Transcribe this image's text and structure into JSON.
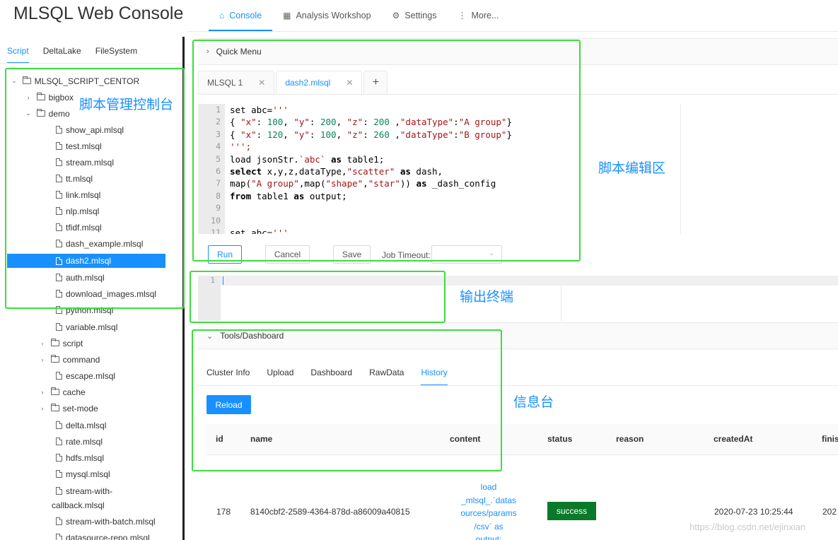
{
  "header": {
    "app_title": "MLSQL Web Console",
    "nav": [
      {
        "label": "Console",
        "icon": "home-icon",
        "active": true
      },
      {
        "label": "Analysis Workshop",
        "icon": "grid-icon",
        "active": false
      },
      {
        "label": "Settings",
        "icon": "gear-icon",
        "active": false
      },
      {
        "label": "More...",
        "icon": "more-icon",
        "active": false
      }
    ]
  },
  "sidebar": {
    "tabs": [
      "Script",
      "DeltaLake",
      "FileSystem"
    ],
    "active_tab": "Script",
    "tree": [
      {
        "label": "MLSQL_SCRIPT_CENTOR",
        "type": "folder",
        "expanded": true
      },
      {
        "label": "bigbox",
        "type": "folder",
        "expanded": false
      },
      {
        "label": "demo",
        "type": "folder",
        "expanded": true
      },
      {
        "label": "show_api.mlsql",
        "type": "file"
      },
      {
        "label": "test.mlsql",
        "type": "file"
      },
      {
        "label": "stream.mlsql",
        "type": "file"
      },
      {
        "label": "tt.mlsql",
        "type": "file"
      },
      {
        "label": "link.mlsql",
        "type": "file"
      },
      {
        "label": "nlp.mlsql",
        "type": "file"
      },
      {
        "label": "tfidf.mlsql",
        "type": "file"
      },
      {
        "label": "dash_example.mlsql",
        "type": "file"
      },
      {
        "label": "dash2.mlsql",
        "type": "file",
        "selected": true
      },
      {
        "label": "auth.mlsql",
        "type": "file"
      },
      {
        "label": "download_images.mlsql",
        "type": "file"
      },
      {
        "label": "python.mlsql",
        "type": "file"
      },
      {
        "label": "variable.mlsql",
        "type": "file"
      },
      {
        "label": "script",
        "type": "folder",
        "expanded": false
      },
      {
        "label": "command",
        "type": "folder",
        "expanded": false
      },
      {
        "label": "escape.mlsql",
        "type": "file"
      },
      {
        "label": "cache",
        "type": "folder",
        "expanded": false
      },
      {
        "label": "set-mode",
        "type": "folder",
        "expanded": false
      },
      {
        "label": "delta.mlsql",
        "type": "file"
      },
      {
        "label": "rate.mlsql",
        "type": "file"
      },
      {
        "label": "hdfs.mlsql",
        "type": "file"
      },
      {
        "label": "mysql.mlsql",
        "type": "file"
      },
      {
        "label": "stream-with-",
        "label2": "callback.mlsql",
        "type": "file"
      },
      {
        "label": "stream-with-batch.mlsql",
        "type": "file"
      },
      {
        "label": "datasource-repo.mlsql",
        "type": "file"
      }
    ]
  },
  "quick_menu": {
    "label": "Quick Menu"
  },
  "editor": {
    "tabs": [
      {
        "label": "MLSQL 1",
        "active": false
      },
      {
        "label": "dash2.mlsql",
        "active": true
      }
    ],
    "add_tab": "+",
    "close_glyph": "✕",
    "line_numbers": [
      "1",
      "2",
      "3",
      "4",
      "5",
      "6",
      "7",
      "8",
      "9",
      "10",
      "11"
    ],
    "buttons": {
      "run": "Run",
      "cancel": "Cancel",
      "save": "Save"
    },
    "job_timeout_label": "Job Timeout:",
    "job_timeout_value": ""
  },
  "output": {
    "line_numbers": [
      "1"
    ]
  },
  "tools": {
    "label": "Tools/Dashboard",
    "tabs": [
      "Cluster Info",
      "Upload",
      "Dashboard",
      "RawData",
      "History"
    ],
    "active_tab": "History",
    "reload": "Reload",
    "table": {
      "headers": [
        "id",
        "name",
        "content",
        "status",
        "reason",
        "createdAt",
        "finis"
      ],
      "rows": [
        {
          "id": "178",
          "name": "8140cbf2-2589-4364-878d-a86009a40815",
          "content": [
            "load",
            "_mlsql_.`datas",
            "ources/params",
            "/csv` as",
            "output;"
          ],
          "status": "success",
          "reason": "",
          "createdAt": "2020-07-23 10:25:44",
          "finis": "202"
        }
      ]
    }
  },
  "annotations": {
    "script_manager": "脚本管理控制台",
    "script_editor": "脚本编辑区",
    "output_terminal": "输出终端",
    "info_console": "信息台"
  },
  "watermark": "https://blog.csdn.net/ejinxian",
  "colors": {
    "accent": "#1890ff",
    "annotation": "#3ddc3d",
    "success": "#0a7a2a"
  }
}
